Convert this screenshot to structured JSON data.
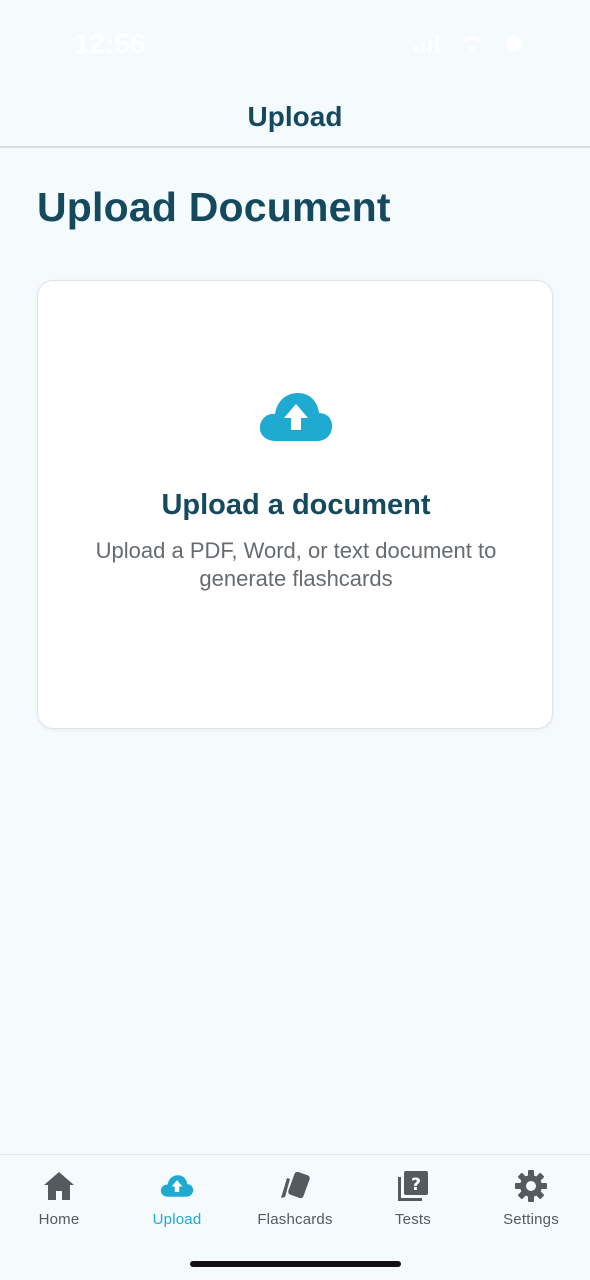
{
  "status_bar": {
    "time": "12:56"
  },
  "header": {
    "title": "Upload"
  },
  "page": {
    "title": "Upload Document"
  },
  "upload_card": {
    "icon": "cloud-upload-icon",
    "heading": "Upload a document",
    "description": "Upload a PDF, Word, or text document to generate flashcards"
  },
  "tabs": [
    {
      "label": "Home",
      "icon": "home-icon",
      "active": false
    },
    {
      "label": "Upload",
      "icon": "cloud-upload-icon",
      "active": true
    },
    {
      "label": "Flashcards",
      "icon": "cards-icon",
      "active": false
    },
    {
      "label": "Tests",
      "icon": "quiz-icon",
      "active": false
    },
    {
      "label": "Settings",
      "icon": "gear-icon",
      "active": false
    }
  ],
  "colors": {
    "primary_text": "#15495e",
    "accent": "#1eaad1",
    "tab_inactive": "#545a5f",
    "background": "#f5fafd",
    "card": "#ffffff"
  }
}
